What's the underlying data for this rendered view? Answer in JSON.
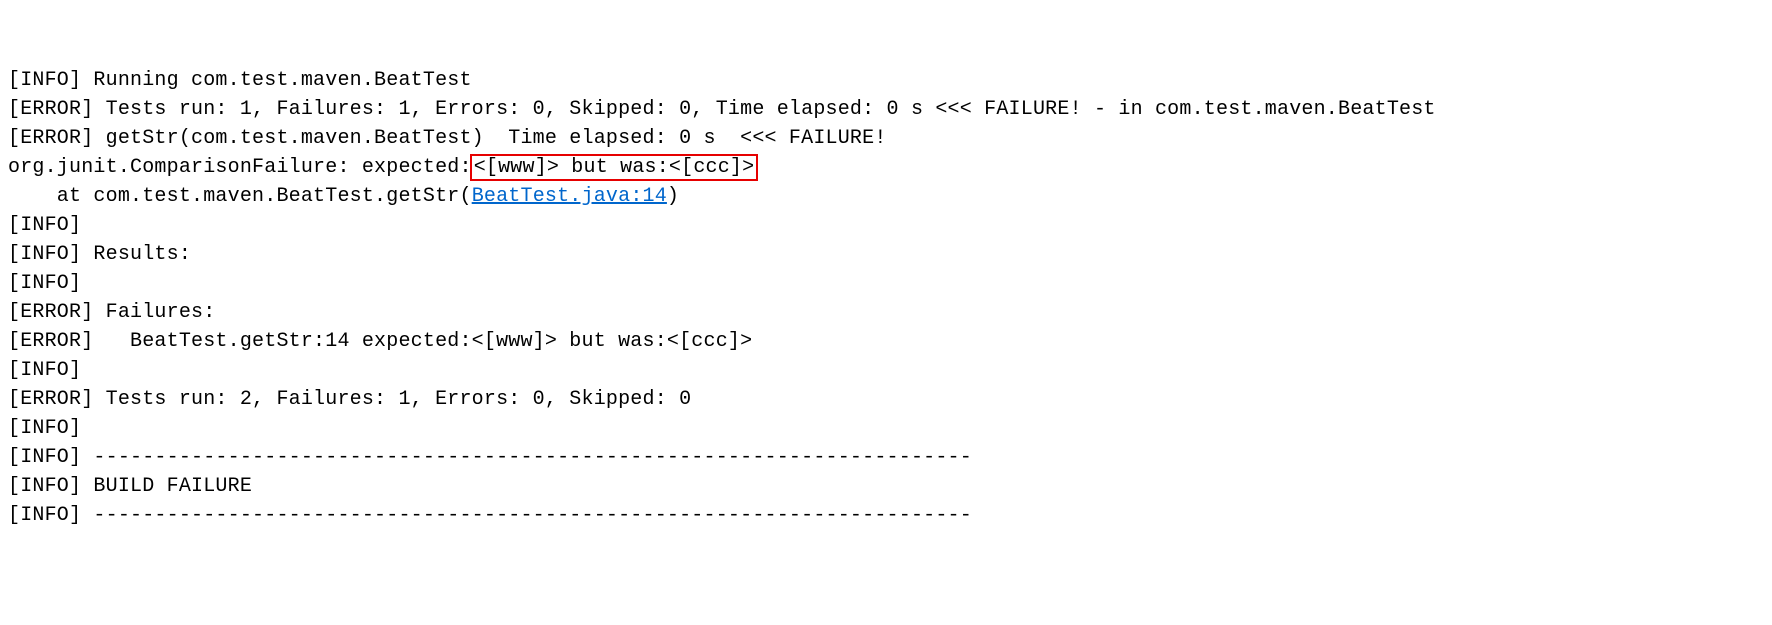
{
  "lines": {
    "l1_a": "[INFO] Running com.test.maven.BeatTest",
    "l2_a": "[ERROR] Tests run: 1, Failures: 1, Errors: 0, Skipped: 0, Time elapsed: 0 s <<< FAILURE! - in com.test.maven.BeatTest",
    "l3_a": "[ERROR] getStr(com.test.maven.BeatTest)  Time elapsed: 0 s  <<< FAILURE!",
    "l4_a": "org.junit.ComparisonFailure: expected:",
    "l4_hl": "<[www]> but was:<[ccc]>",
    "l5_a": "    at com.test.maven.BeatTest.getStr(",
    "l5_link": "BeatTest.java:14",
    "l5_b": ")",
    "blank": "",
    "l6_a": "[INFO]",
    "l7_a": "[INFO] Results:",
    "l8_a": "[INFO]",
    "l9_a": "[ERROR] Failures:",
    "l10_a": "[ERROR]   BeatTest.getStr:14 expected:<[www]> but was:<[ccc]>",
    "l11_a": "[INFO]",
    "l12_a": "[ERROR] Tests run: 2, Failures: 1, Errors: 0, Skipped: 0",
    "l13_a": "[INFO]",
    "l14_a": "[INFO] ------------------------------------------------------------------------",
    "l15_a": "[INFO] BUILD FAILURE",
    "l16_a": "[INFO] ------------------------------------------------------------------------"
  }
}
